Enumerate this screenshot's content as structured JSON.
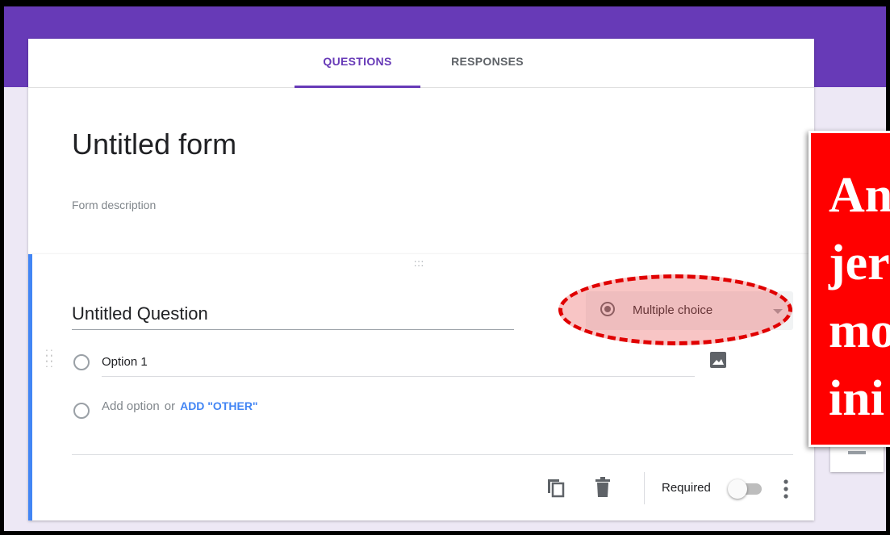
{
  "tabs": [
    {
      "label": "QUESTIONS",
      "active": true
    },
    {
      "label": "RESPONSES",
      "active": false
    }
  ],
  "form": {
    "title": "Untitled form",
    "description_placeholder": "Form description"
  },
  "question": {
    "title": "Untitled Question",
    "type": "Multiple choice",
    "type_icon": "radio-button-checked-icon",
    "options": [
      "Option 1"
    ],
    "add_option_label": "Add option",
    "or_label": "or",
    "add_other_label": "ADD \"OTHER\""
  },
  "footer": {
    "required_label": "Required",
    "required_on": false
  },
  "annotation": {
    "lines": [
      "An",
      "jer",
      "mo",
      "ini"
    ]
  },
  "colors": {
    "header": "#673ab7",
    "accent_border": "#4285f4",
    "link": "#4285f4",
    "highlight": "#e00000",
    "banner": "#ff0000"
  }
}
